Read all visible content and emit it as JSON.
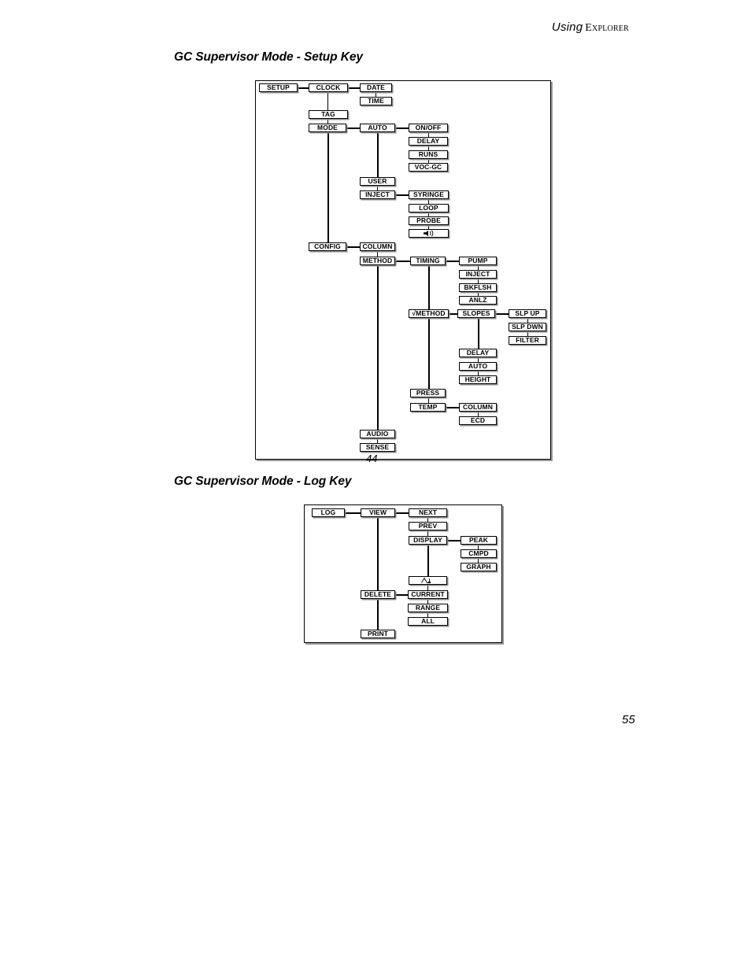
{
  "header": {
    "using": "Using",
    "product": "Explorer"
  },
  "page_number": "55",
  "sections": [
    {
      "heading": "GC Supervisor Mode - Setup Key",
      "caption": "44"
    },
    {
      "heading": "GC Supervisor Mode - Log Key",
      "caption": ""
    }
  ],
  "setup_diagram": {
    "title": "GC Supervisor Mode - Setup Key",
    "figure_number": "44",
    "nodes": {
      "setup": "SETUP",
      "clock": "CLOCK",
      "date": "DATE",
      "time": "TIME",
      "tag": "TAG",
      "mode": "MODE",
      "auto": "AUTO",
      "onoff": "ON/OFF",
      "delay1": "DELAY",
      "runs": "RUNS",
      "vocgc": "VOC-GC",
      "user": "USER",
      "inject": "INJECT",
      "syringe": "SYRINGE",
      "loop": "LOOP",
      "probe": "PROBE",
      "speaker": "speaker-icon",
      "config": "CONFIG",
      "column1": "COLUMN",
      "method": "METHOD",
      "timing": "TIMING",
      "pump": "PUMP",
      "inject2": "INJECT",
      "bkflsh": "BKFLSH",
      "anlz": "ANLZ",
      "check_method": "√METHOD",
      "slopes": "SLOPES",
      "slp_up": "SLP UP",
      "slp_dwn": "SLP DWN",
      "filter": "FILTER",
      "delay2": "DELAY",
      "auto2": "AUTO",
      "height": "HEIGHT",
      "press": "PRESS",
      "temp": "TEMP",
      "column2": "COLUMN",
      "ecd": "ECD",
      "audio": "AUDIO",
      "sense": "SENSE"
    }
  },
  "log_diagram": {
    "title": "GC Supervisor Mode - Log Key",
    "nodes": {
      "log": "LOG",
      "view": "VIEW",
      "next": "NEXT",
      "prev": "PREV",
      "display": "DISPLAY",
      "peak": "PEAK",
      "cmpd": "CMPD",
      "graph": "GRAPH",
      "chromatogram": "chromatogram-icon",
      "delete": "DELETE",
      "current": "CURRENT",
      "range": "RANGE",
      "all": "ALL",
      "print": "PRINT"
    }
  },
  "colors": {
    "text": "#000000",
    "background": "#ffffff",
    "shadow": "#8e8e8e",
    "line": "#000000"
  }
}
